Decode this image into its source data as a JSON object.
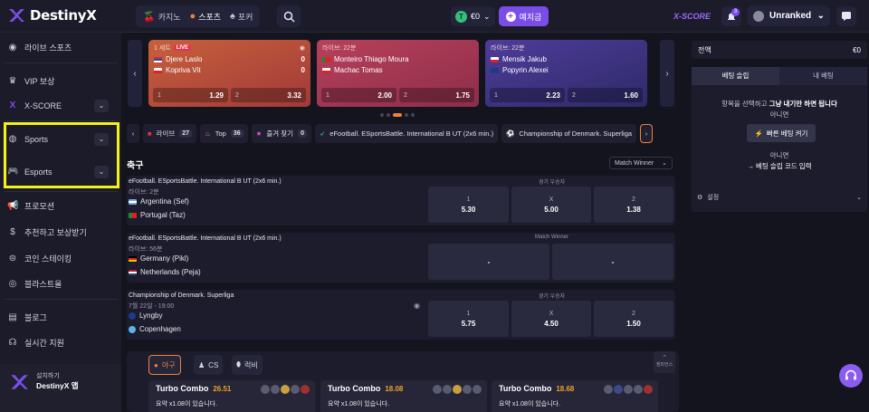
{
  "colors": {
    "accent": "#7b4de8",
    "highlight": "#f4f21a",
    "orange": "#f0813c",
    "live": "#e8324a"
  },
  "header": {
    "brand": "DestinyX",
    "tabs": [
      {
        "icon": "cherries-icon",
        "label": "카지노"
      },
      {
        "icon": "basketball-icon",
        "label": "스포츠"
      },
      {
        "icon": "spade-icon",
        "label": "포커"
      }
    ],
    "balance": "€0",
    "coin_symbol": "T",
    "deposit": "예치금",
    "xscore": "X-SCORE",
    "notifications": "3",
    "rank": "Unranked"
  },
  "sidebar": {
    "live_sports": "라이브 스포츠",
    "vip": "VIP 보상",
    "xscore": "X-SCORE",
    "sports": "Sports",
    "esports": "Esports",
    "promotions": "프로모션",
    "referral": "추천하고 보상받기",
    "coin_staking": "코인 스테이킹",
    "blast_table": "블라스트올",
    "blog": "블로그",
    "live_support": "실시간 지원",
    "install_label": "설치하기",
    "install_app": "DestinyX 앱"
  },
  "live_cards": [
    {
      "header": "1 세트",
      "live": "LIVE",
      "team1": "Djere Laslo",
      "team2": "Kopriva Vit",
      "score1": "0",
      "score2": "0",
      "odd1_label": "1",
      "odd1": "1.29",
      "odd2_label": "2",
      "odd2": "3.32"
    },
    {
      "header": "라이브: 22분",
      "team1": "Monteiro Thiago Moura",
      "team2": "Machac Tomas",
      "odd1_label": "1",
      "odd1": "2.00",
      "odd2_label": "2",
      "odd2": "1.75"
    },
    {
      "header": "라이브: 22분",
      "team1": "Mensik Jakub",
      "team2": "Popyrin Alexei",
      "odd1_label": "1",
      "odd1": "2.23",
      "odd2_label": "2",
      "odd2": "1.60"
    }
  ],
  "chips": [
    {
      "label": "라이브",
      "count": "27"
    },
    {
      "label": "Top",
      "count": "36"
    },
    {
      "label": "즐겨 찾기",
      "count": "0"
    },
    {
      "label": "eFootball. ESportsBattle. International B UT (2x6 min.)"
    },
    {
      "label": "Championship of Denmark. Superliga"
    }
  ],
  "section": {
    "title": "축구",
    "market_select": "Match Winner"
  },
  "events": [
    {
      "league": "eFootball. ESportsBattle. International B UT (2x6 min.)",
      "time": "라이브: 2분",
      "team1": "Argentina (Sef)",
      "team2": "Portugal (Taz)",
      "market": "경기 우승자",
      "o1_label": "1",
      "o1": "5.30",
      "ox_label": "X",
      "ox": "5.00",
      "o2_label": "2",
      "o2": "1.38"
    },
    {
      "league": "eFootball. ESportsBattle. International B UT (2x6 min.)",
      "time": "라이브: 56분",
      "team1": "Germany (Pikl)",
      "team2": "Netherlands (Peja)",
      "market": "Match Winner",
      "o1": "-",
      "o2": "-"
    },
    {
      "league": "Championship of Denmark. Superliga",
      "time": "7월 22일 - 19:00",
      "team1": "Lyngby",
      "team2": "Copenhagen",
      "market": "경기 우승자",
      "o1_label": "1",
      "o1": "5.75",
      "ox_label": "X",
      "ox": "4.50",
      "o2_label": "2",
      "o2": "1.50"
    }
  ],
  "bottom": {
    "tabs": [
      "야구",
      "CS",
      "럭비"
    ],
    "more": "챔피언스",
    "combos": [
      {
        "title": "Turbo Combo",
        "value": "26.51",
        "sub": "요약 x1.08이 있습니다."
      },
      {
        "title": "Turbo Combo",
        "value": "18.08",
        "sub": "요약 x1.08이 있습니다."
      },
      {
        "title": "Turbo Combo",
        "value": "18.68",
        "sub": "요약 x1.08이 있습니다."
      }
    ]
  },
  "betslip": {
    "total_label": "전액",
    "total_value": "€0",
    "tab_slip": "베팅 슬립",
    "tab_my": "내 베팅",
    "message_pre": "항목을 선택하고 ",
    "message_bold": "그냥 내기만 하면 됩니다",
    "or1": "아니면",
    "quick_bet": "빠른 베팅 켜기",
    "or2": "아니면",
    "code_link": "→ 베팅 슬립 코드 입력",
    "settings": "설정"
  }
}
